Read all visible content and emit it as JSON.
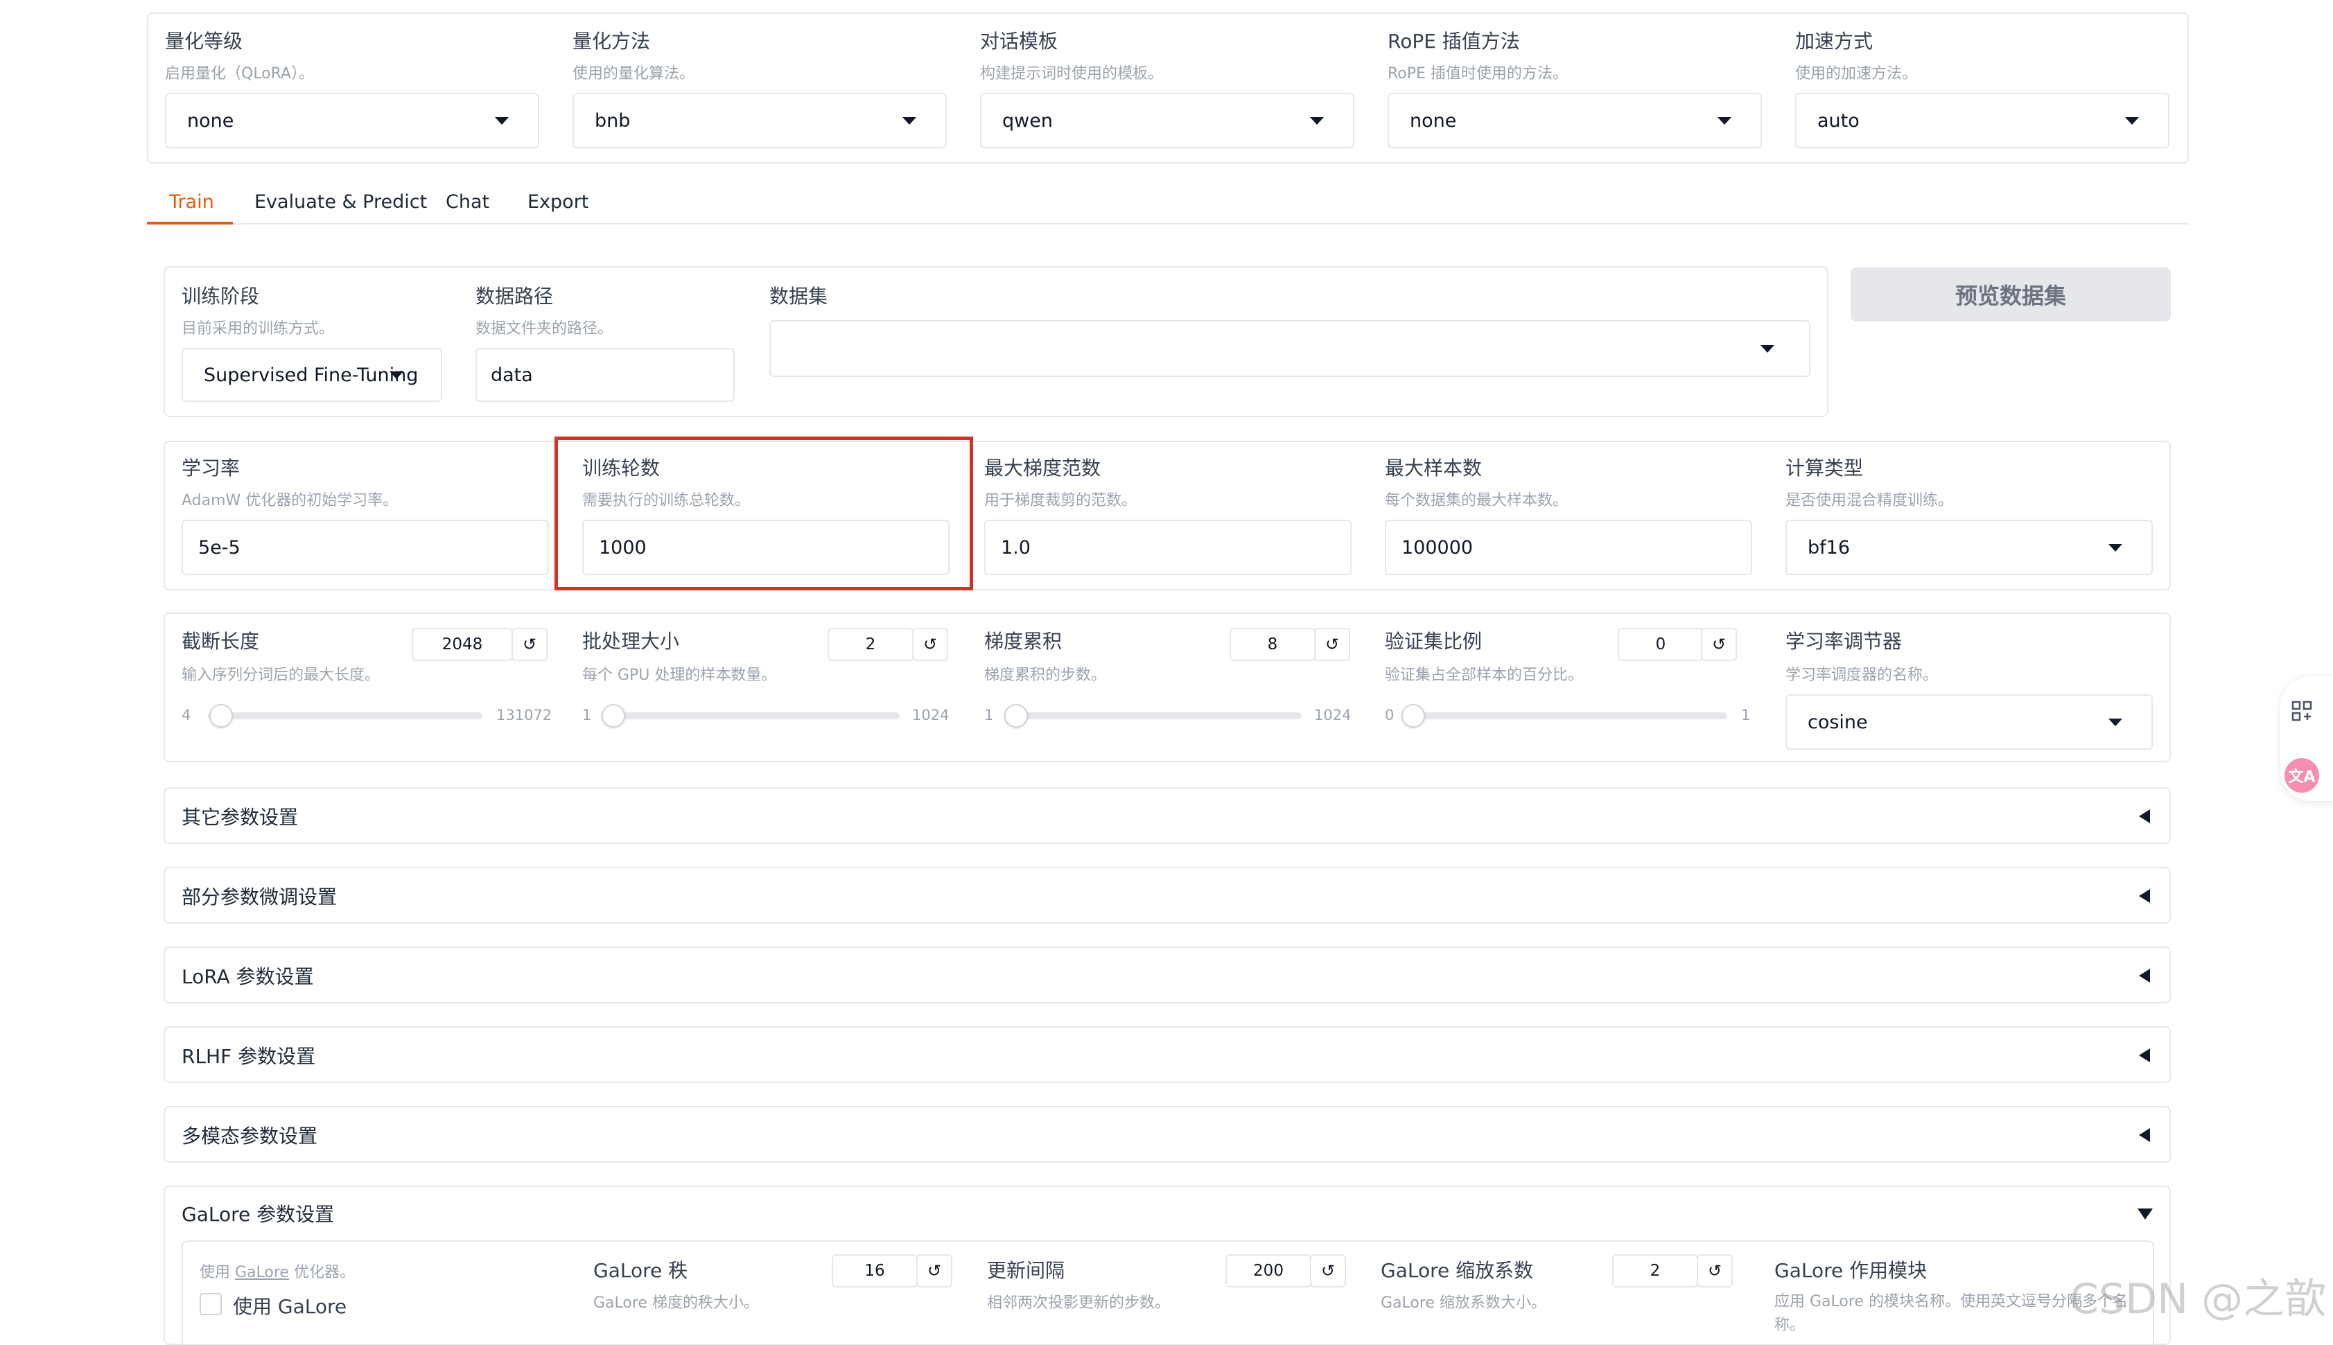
{
  "top_row": [
    {
      "label": "量化等级",
      "info": "启用量化（QLoRA）。",
      "value": "none"
    },
    {
      "label": "量化方法",
      "info": "使用的量化算法。",
      "value": "bnb"
    },
    {
      "label": "对话模板",
      "info": "构建提示词时使用的模板。",
      "value": "qwen"
    },
    {
      "label": "RoPE 插值方法",
      "info": "RoPE 插值时使用的方法。",
      "value": "none"
    },
    {
      "label": "加速方式",
      "info": "使用的加速方法。",
      "value": "auto"
    }
  ],
  "tabs": [
    "Train",
    "Evaluate & Predict",
    "Chat",
    "Export"
  ],
  "active_tab": "Train",
  "dataset_row": {
    "stage": {
      "label": "训练阶段",
      "info": "目前采用的训练方式。",
      "value": "Supervised Fine-Tuning"
    },
    "path": {
      "label": "数据路径",
      "info": "数据文件夹的路径。",
      "value": "data"
    },
    "dataset": {
      "label": "数据集",
      "value": ""
    },
    "preview_button": "预览数据集"
  },
  "params_row": [
    {
      "label": "学习率",
      "info": "AdamW 优化器的初始学习率。",
      "value": "5e-5"
    },
    {
      "label": "训练轮数",
      "info": "需要执行的训练总轮数。",
      "value": "1000"
    },
    {
      "label": "最大梯度范数",
      "info": "用于梯度裁剪的范数。",
      "value": "1.0"
    },
    {
      "label": "最大样本数",
      "info": "每个数据集的最大样本数。",
      "value": "100000"
    },
    {
      "label": "计算类型",
      "info": "是否使用混合精度训练。",
      "value": "bf16"
    }
  ],
  "sliders_row": [
    {
      "label": "截断长度",
      "info": "输入序列分词后的最大长度。",
      "value": "2048",
      "min": "4",
      "max": "131072",
      "fraction": 0.015
    },
    {
      "label": "批处理大小",
      "info": "每个 GPU 处理的样本数量。",
      "value": "2",
      "min": "1",
      "max": "1024",
      "fraction": 0.001
    },
    {
      "label": "梯度累积",
      "info": "梯度累积的步数。",
      "value": "8",
      "min": "1",
      "max": "1024",
      "fraction": 0.007
    },
    {
      "label": "验证集比例",
      "info": "验证集占全部样本的百分比。",
      "value": "0",
      "min": "0",
      "max": "1",
      "fraction": 0.0
    }
  ],
  "scheduler": {
    "label": "学习率调节器",
    "info": "学习率调度器的名称。",
    "value": "cosine"
  },
  "accordions": [
    "其它参数设置",
    "部分参数微调设置",
    "LoRA 参数设置",
    "RLHF 参数设置",
    "多模态参数设置"
  ],
  "galore": {
    "title": "GaLore 参数设置",
    "use_info_prefix": "使用 ",
    "use_info_link": "GaLore",
    "use_info_suffix": " 优化器。",
    "use_label": "使用 GaLore",
    "rank": {
      "label": "GaLore 秩",
      "info": "GaLore 梯度的秩大小。",
      "value": "16"
    },
    "interval": {
      "label": "更新间隔",
      "info": "相邻两次投影更新的步数。",
      "value": "200"
    },
    "scale": {
      "label": "GaLore 缩放系数",
      "info": "GaLore 缩放系数大小。",
      "value": "2"
    },
    "target": {
      "label": "GaLore 作用模块",
      "info": "应用 GaLore 的模块名称。使用英文逗号分隔多个名称。"
    }
  },
  "watermark": "CSDN @之歆",
  "highlight_color": "#d93025",
  "accent_color": "#ea580c",
  "side_icons": [
    "grid-icon",
    "translate-icon"
  ]
}
